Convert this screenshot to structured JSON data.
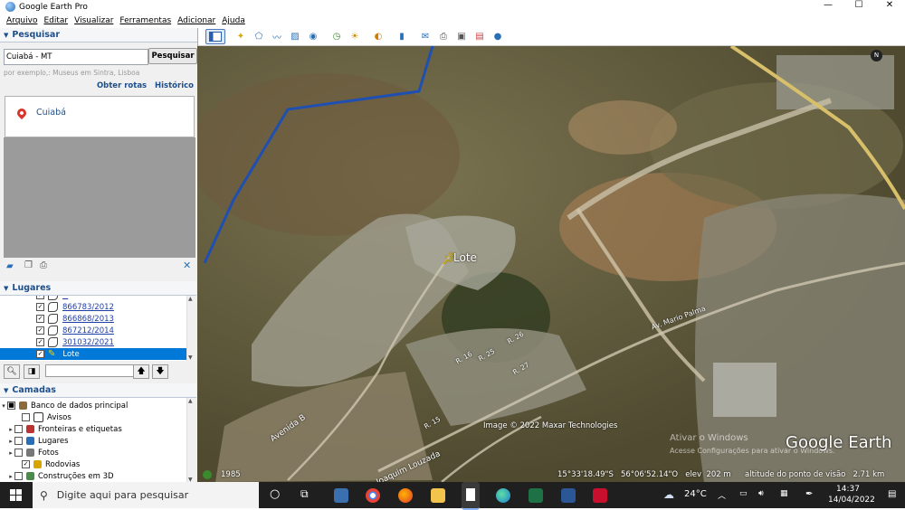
{
  "window": {
    "title": "Google Earth Pro",
    "controls": {
      "minimize": "—",
      "maximize": "☐",
      "close": "✕"
    }
  },
  "menu": [
    "Arquivo",
    "Editar",
    "Visualizar",
    "Ferramentas",
    "Adicionar",
    "Ajuda"
  ],
  "search": {
    "header": "Pesquisar",
    "value": "Cuiabá - MT",
    "button": "Pesquisar",
    "example": "por exemplo,: Museus em Sintra, Lisboa",
    "link_routes": "Obter rotas",
    "link_history": "Histórico",
    "result": "Cuiabá"
  },
  "places": {
    "header": "Lugares",
    "items": [
      {
        "label": "866783/2012",
        "checked": "✓"
      },
      {
        "label": "866868/2013",
        "checked": "✓"
      },
      {
        "label": "867212/2014",
        "checked": "✓"
      },
      {
        "label": "301032/2021",
        "checked": "✓"
      },
      {
        "label": "Lote",
        "checked": "✓"
      }
    ]
  },
  "layers": {
    "header": "Camadas",
    "items": [
      {
        "label": "Banco de dados principal",
        "checked": "■"
      },
      {
        "label": "Avisos",
        "checked": ""
      },
      {
        "label": "Fronteiras e etiquetas",
        "checked": ""
      },
      {
        "label": "Lugares",
        "checked": ""
      },
      {
        "label": "Fotos",
        "checked": ""
      },
      {
        "label": "Rodovias",
        "checked": "✓"
      },
      {
        "label": "Construções em 3D",
        "checked": ""
      }
    ]
  },
  "map": {
    "placemark": "Lote",
    "street_1": "Avenida B",
    "street_2": "Av. Mario Palma",
    "street_3": "Joaquim Louzada",
    "street_4": "R. 15",
    "street_5": "R. 16",
    "street_6": "R. 25",
    "street_7": "R. 26",
    "street_8": "R. 27",
    "copyright": "Image © 2022 Maxar Technologies",
    "activate_1": "Ativar o Windows",
    "activate_2": "Acesse Configurações para ativar o Windows.",
    "brand": "Google Earth",
    "compass": "N",
    "year": "1985",
    "coords": "15°33'18.49\"S   56°06'52.14\"O   elev  202 m",
    "eye_alt": "altitude do ponto de visão   2.71 km"
  },
  "taskbar": {
    "search_placeholder": "Digite aqui para pesquisar",
    "temperature": "24°C",
    "time": "14:37",
    "date": "14/04/2022"
  },
  "colors": {
    "accent": "#1d4f8c",
    "selection": "#0078d7",
    "route": "#1f4fb0",
    "taskbar": "#1f1f1f"
  }
}
